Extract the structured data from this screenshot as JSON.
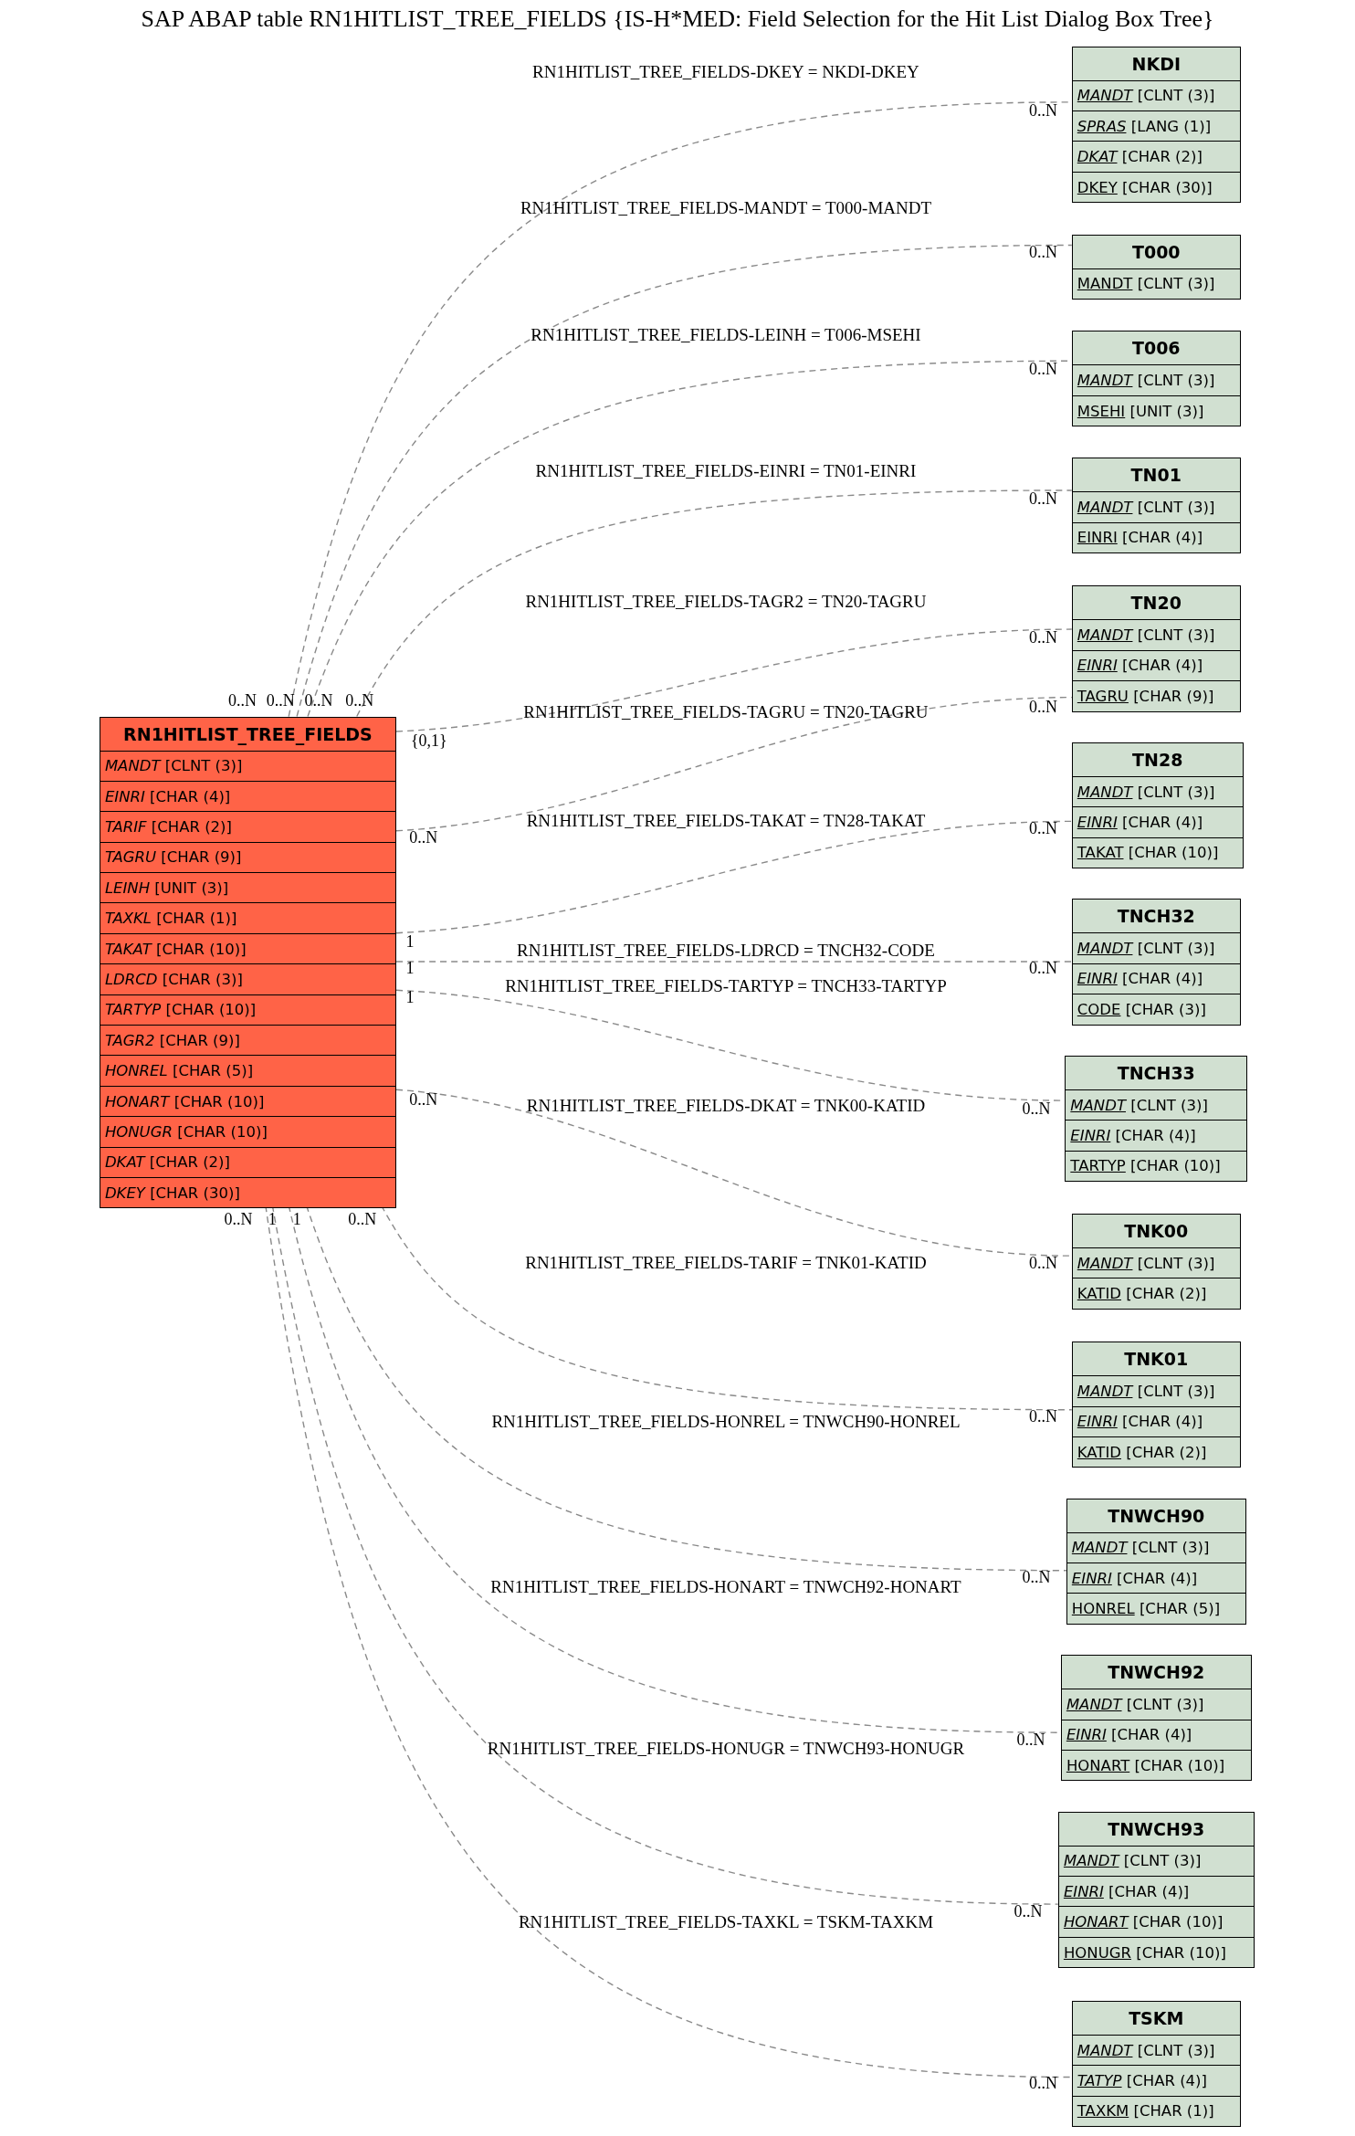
{
  "title": "SAP ABAP table RN1HITLIST_TREE_FIELDS {IS-H*MED: Field Selection for the Hit List Dialog Box Tree}",
  "main_table": {
    "name": "RN1HITLIST_TREE_FIELDS",
    "fields": [
      {
        "name": "MANDT",
        "type": "[CLNT (3)]",
        "key": false,
        "foreign": true
      },
      {
        "name": "EINRI",
        "type": "[CHAR (4)]",
        "key": false,
        "foreign": true
      },
      {
        "name": "TARIF",
        "type": "[CHAR (2)]",
        "key": false,
        "foreign": true
      },
      {
        "name": "TAGRU",
        "type": "[CHAR (9)]",
        "key": false,
        "foreign": true
      },
      {
        "name": "LEINH",
        "type": "[UNIT (3)]",
        "key": false,
        "foreign": true
      },
      {
        "name": "TAXKL",
        "type": "[CHAR (1)]",
        "key": false,
        "foreign": true
      },
      {
        "name": "TAKAT",
        "type": "[CHAR (10)]",
        "key": false,
        "foreign": true
      },
      {
        "name": "LDRCD",
        "type": "[CHAR (3)]",
        "key": false,
        "foreign": true
      },
      {
        "name": "TARTYP",
        "type": "[CHAR (10)]",
        "key": false,
        "foreign": true
      },
      {
        "name": "TAGR2",
        "type": "[CHAR (9)]",
        "key": false,
        "foreign": true
      },
      {
        "name": "HONREL",
        "type": "[CHAR (5)]",
        "key": false,
        "foreign": true
      },
      {
        "name": "HONART",
        "type": "[CHAR (10)]",
        "key": false,
        "foreign": true
      },
      {
        "name": "HONUGR",
        "type": "[CHAR (10)]",
        "key": false,
        "foreign": true
      },
      {
        "name": "DKAT",
        "type": "[CHAR (2)]",
        "key": false,
        "foreign": true
      },
      {
        "name": "DKEY",
        "type": "[CHAR (30)]",
        "key": false,
        "foreign": true
      }
    ]
  },
  "tables": [
    {
      "name": "NKDI",
      "fields": [
        {
          "name": "MANDT",
          "type": "[CLNT (3)]",
          "key": true,
          "foreign": true
        },
        {
          "name": "SPRAS",
          "type": "[LANG (1)]",
          "key": true,
          "foreign": true
        },
        {
          "name": "DKAT",
          "type": "[CHAR (2)]",
          "key": true,
          "foreign": true
        },
        {
          "name": "DKEY",
          "type": "[CHAR (30)]",
          "key": true,
          "foreign": false
        }
      ]
    },
    {
      "name": "T000",
      "fields": [
        {
          "name": "MANDT",
          "type": "[CLNT (3)]",
          "key": true,
          "foreign": false
        }
      ]
    },
    {
      "name": "T006",
      "fields": [
        {
          "name": "MANDT",
          "type": "[CLNT (3)]",
          "key": true,
          "foreign": true
        },
        {
          "name": "MSEHI",
          "type": "[UNIT (3)]",
          "key": true,
          "foreign": false
        }
      ]
    },
    {
      "name": "TN01",
      "fields": [
        {
          "name": "MANDT",
          "type": "[CLNT (3)]",
          "key": true,
          "foreign": true
        },
        {
          "name": "EINRI",
          "type": "[CHAR (4)]",
          "key": true,
          "foreign": false
        }
      ]
    },
    {
      "name": "TN20",
      "fields": [
        {
          "name": "MANDT",
          "type": "[CLNT (3)]",
          "key": true,
          "foreign": true
        },
        {
          "name": "EINRI",
          "type": "[CHAR (4)]",
          "key": true,
          "foreign": true
        },
        {
          "name": "TAGRU",
          "type": "[CHAR (9)]",
          "key": true,
          "foreign": false
        }
      ]
    },
    {
      "name": "TN28",
      "fields": [
        {
          "name": "MANDT",
          "type": "[CLNT (3)]",
          "key": true,
          "foreign": true
        },
        {
          "name": "EINRI",
          "type": "[CHAR (4)]",
          "key": true,
          "foreign": true
        },
        {
          "name": "TAKAT",
          "type": "[CHAR (10)]",
          "key": true,
          "foreign": false
        }
      ]
    },
    {
      "name": "TNCH32",
      "fields": [
        {
          "name": "MANDT",
          "type": "[CLNT (3)]",
          "key": true,
          "foreign": true
        },
        {
          "name": "EINRI",
          "type": "[CHAR (4)]",
          "key": true,
          "foreign": true
        },
        {
          "name": "CODE",
          "type": "[CHAR (3)]",
          "key": true,
          "foreign": false
        }
      ]
    },
    {
      "name": "TNCH33",
      "fields": [
        {
          "name": "MANDT",
          "type": "[CLNT (3)]",
          "key": true,
          "foreign": true
        },
        {
          "name": "EINRI",
          "type": "[CHAR (4)]",
          "key": true,
          "foreign": true
        },
        {
          "name": "TARTYP",
          "type": "[CHAR (10)]",
          "key": true,
          "foreign": false
        }
      ]
    },
    {
      "name": "TNK00",
      "fields": [
        {
          "name": "MANDT",
          "type": "[CLNT (3)]",
          "key": true,
          "foreign": true
        },
        {
          "name": "KATID",
          "type": "[CHAR (2)]",
          "key": true,
          "foreign": false
        }
      ]
    },
    {
      "name": "TNK01",
      "fields": [
        {
          "name": "MANDT",
          "type": "[CLNT (3)]",
          "key": true,
          "foreign": true
        },
        {
          "name": "EINRI",
          "type": "[CHAR (4)]",
          "key": true,
          "foreign": true
        },
        {
          "name": "KATID",
          "type": "[CHAR (2)]",
          "key": true,
          "foreign": false
        }
      ]
    },
    {
      "name": "TNWCH90",
      "fields": [
        {
          "name": "MANDT",
          "type": "[CLNT (3)]",
          "key": true,
          "foreign": true
        },
        {
          "name": "EINRI",
          "type": "[CHAR (4)]",
          "key": true,
          "foreign": true
        },
        {
          "name": "HONREL",
          "type": "[CHAR (5)]",
          "key": true,
          "foreign": false
        }
      ]
    },
    {
      "name": "TNWCH92",
      "fields": [
        {
          "name": "MANDT",
          "type": "[CLNT (3)]",
          "key": true,
          "foreign": true
        },
        {
          "name": "EINRI",
          "type": "[CHAR (4)]",
          "key": true,
          "foreign": true
        },
        {
          "name": "HONART",
          "type": "[CHAR (10)]",
          "key": true,
          "foreign": false
        }
      ]
    },
    {
      "name": "TNWCH93",
      "fields": [
        {
          "name": "MANDT",
          "type": "[CLNT (3)]",
          "key": true,
          "foreign": true
        },
        {
          "name": "EINRI",
          "type": "[CHAR (4)]",
          "key": true,
          "foreign": true
        },
        {
          "name": "HONART",
          "type": "[CHAR (10)]",
          "key": true,
          "foreign": true
        },
        {
          "name": "HONUGR",
          "type": "[CHAR (10)]",
          "key": true,
          "foreign": false
        }
      ]
    },
    {
      "name": "TSKM",
      "fields": [
        {
          "name": "MANDT",
          "type": "[CLNT (3)]",
          "key": true,
          "foreign": true
        },
        {
          "name": "TATYP",
          "type": "[CHAR (4)]",
          "key": true,
          "foreign": true
        },
        {
          "name": "TAXKM",
          "type": "[CHAR (1)]",
          "key": true,
          "foreign": false
        }
      ]
    }
  ],
  "relations": [
    {
      "label": "RN1HITLIST_TREE_FIELDS-DKEY = NKDI-DKEY",
      "from_card": "0..N",
      "to_card": "0..N"
    },
    {
      "label": "RN1HITLIST_TREE_FIELDS-MANDT = T000-MANDT",
      "from_card": "0..N",
      "to_card": "0..N"
    },
    {
      "label": "RN1HITLIST_TREE_FIELDS-LEINH = T006-MSEHI",
      "from_card": "0..N",
      "to_card": "0..N"
    },
    {
      "label": "RN1HITLIST_TREE_FIELDS-EINRI = TN01-EINRI",
      "from_card": "0..N",
      "to_card": "0..N"
    },
    {
      "label": "RN1HITLIST_TREE_FIELDS-TAGR2 = TN20-TAGRU",
      "from_card": "{0,1}",
      "to_card": "0..N"
    },
    {
      "label": "RN1HITLIST_TREE_FIELDS-TAGRU = TN20-TAGRU",
      "from_card": "0..N",
      "to_card": "0..N"
    },
    {
      "label": "RN1HITLIST_TREE_FIELDS-TAKAT = TN28-TAKAT",
      "from_card": "1",
      "to_card": "0..N"
    },
    {
      "label": "RN1HITLIST_TREE_FIELDS-LDRCD = TNCH32-CODE",
      "from_card": "1",
      "to_card": "0..N"
    },
    {
      "label": "RN1HITLIST_TREE_FIELDS-TARTYP = TNCH33-TARTYP",
      "from_card": "1",
      "to_card": "0..N"
    },
    {
      "label": "RN1HITLIST_TREE_FIELDS-DKAT = TNK00-KATID",
      "from_card": "0..N",
      "to_card": "0..N"
    },
    {
      "label": "RN1HITLIST_TREE_FIELDS-TARIF = TNK01-KATID",
      "from_card": "0..N",
      "to_card": "0..N"
    },
    {
      "label": "RN1HITLIST_TREE_FIELDS-HONREL = TNWCH90-HONREL",
      "from_card": "1",
      "to_card": "0..N"
    },
    {
      "label": "RN1HITLIST_TREE_FIELDS-HONART = TNWCH92-HONART",
      "from_card": "1",
      "to_card": "0..N"
    },
    {
      "label": "RN1HITLIST_TREE_FIELDS-HONUGR = TNWCH93-HONUGR",
      "from_card": "0..N",
      "to_card": "0..N"
    },
    {
      "label": "RN1HITLIST_TREE_FIELDS-TAXKL = TSKM-TAXKM",
      "to_card": "0..N"
    }
  ]
}
